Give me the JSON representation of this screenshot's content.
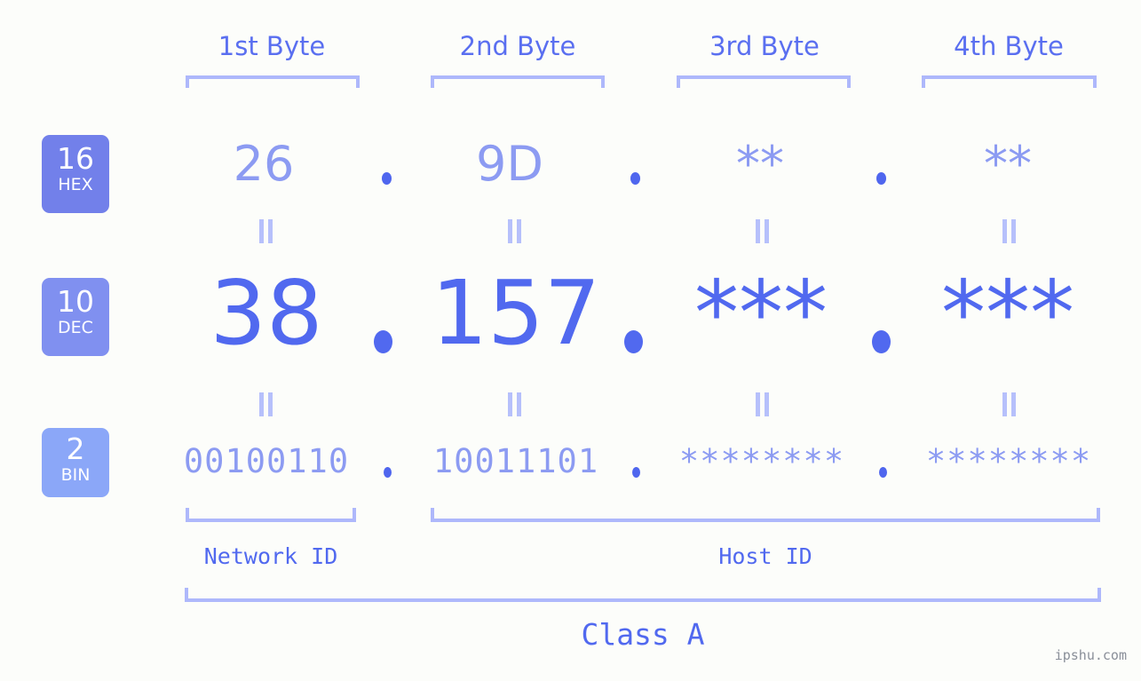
{
  "meta": {
    "background_color": "#fcfdfa",
    "accent_color": "#5169ef",
    "light_accent_color": "#8c9bf2",
    "bracket_color": "#aeb8fb",
    "watermark": "ipshu.com"
  },
  "byte_headers": [
    {
      "label": "1st Byte"
    },
    {
      "label": "2nd Byte"
    },
    {
      "label": "3rd Byte"
    },
    {
      "label": "4th Byte"
    }
  ],
  "bases": [
    {
      "number": "16",
      "name": "HEX",
      "color": "#7280ea"
    },
    {
      "number": "10",
      "name": "DEC",
      "color": "#8090f0"
    },
    {
      "number": "2",
      "name": "BIN",
      "color": "#8ba7f8"
    }
  ],
  "rows": {
    "hex": {
      "base_number": "16",
      "base_name": "HEX",
      "values": [
        "26",
        "9D",
        "**",
        "**"
      ],
      "separator": "."
    },
    "dec": {
      "base_number": "10",
      "base_name": "DEC",
      "values": [
        "38",
        "157",
        "***",
        "***"
      ],
      "separator": "."
    },
    "bin": {
      "base_number": "2",
      "base_name": "BIN",
      "values": [
        "00100110",
        "10011101",
        "********",
        "********"
      ],
      "separator": "."
    }
  },
  "segments": [
    {
      "label": "Network ID"
    },
    {
      "label": "Host ID"
    }
  ],
  "class": {
    "label": "Class A"
  },
  "equals_symbol": "="
}
